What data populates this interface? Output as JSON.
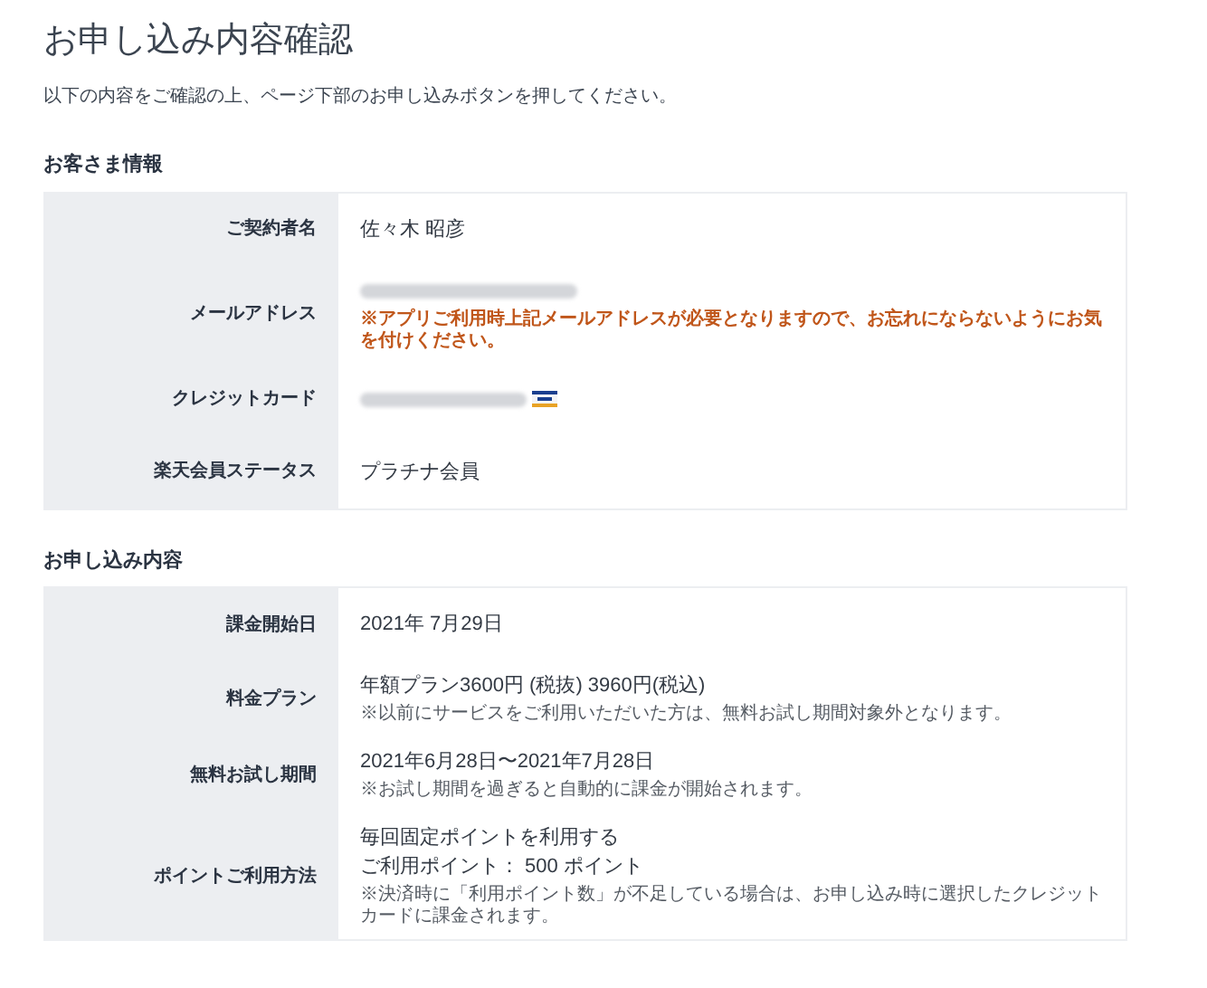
{
  "page": {
    "title": "お申し込み内容確認",
    "intro": "以下の内容をご確認の上、ページ下部のお申し込みボタンを押してください。"
  },
  "sections": [
    {
      "heading": "お客さま情報",
      "rows": [
        {
          "label": "ご契約者名",
          "values": [
            {
              "kind": "text",
              "text": "佐々木 昭彦"
            }
          ]
        },
        {
          "label": "メールアドレス",
          "values": [
            {
              "kind": "redacted"
            }
          ],
          "note": {
            "kind": "warning",
            "text": "※アプリご利用時上記メールアドレスが必要となりますので、お忘れにならないようにお気を付けください。"
          }
        },
        {
          "label": "クレジットカード",
          "values": [
            {
              "kind": "redacted_card"
            }
          ]
        },
        {
          "label": "楽天会員ステータス",
          "values": [
            {
              "kind": "text",
              "text": "プラチナ会員"
            }
          ]
        }
      ]
    },
    {
      "heading": "お申し込み内容",
      "rows": [
        {
          "label": "課金開始日",
          "values": [
            {
              "kind": "text",
              "text": "2021年 7月29日"
            }
          ]
        },
        {
          "label": "料金プラン",
          "values": [
            {
              "kind": "text",
              "text": "年額プラン3600円 (税抜) 3960円(税込)"
            }
          ],
          "note": {
            "kind": "info",
            "text": "※以前にサービスをご利用いただいた方は、無料お試し期間対象外となります。"
          }
        },
        {
          "label": "無料お試し期間",
          "values": [
            {
              "kind": "text",
              "text": "2021年6月28日〜2021年7月28日"
            }
          ],
          "note": {
            "kind": "info",
            "text": "※お試し期間を過ぎると自動的に課金が開始されます。"
          }
        },
        {
          "label": "ポイントご利用方法",
          "values": [
            {
              "kind": "text",
              "text": "毎回固定ポイントを利用する"
            },
            {
              "kind": "text",
              "text": "ご利用ポイント： 500 ポイント"
            }
          ],
          "note": {
            "kind": "info",
            "text": "※決済時に「利用ポイント数」が不足している場合は、お申し込み時に選択したクレジットカードに課金されます。"
          }
        }
      ]
    }
  ]
}
